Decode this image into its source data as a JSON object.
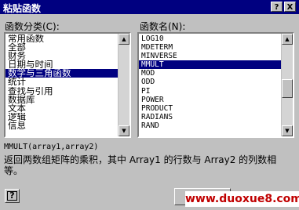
{
  "window": {
    "title": "粘贴函数",
    "help_glyph": "?",
    "close_glyph": "X"
  },
  "category": {
    "label": "函数分类(C):",
    "items": [
      "常用函数",
      "全部",
      "财务",
      "日期与时间",
      "数学与三角函数",
      "统计",
      "查找与引用",
      "数据库",
      "文本",
      "逻辑",
      "信息"
    ],
    "selected_index": 4
  },
  "function_names": {
    "label": "函数名(N):",
    "items": [
      "LOG10",
      "MDETERM",
      "MINVERSE",
      "MMULT",
      "MOD",
      "ODD",
      "PI",
      "POWER",
      "PRODUCT",
      "RADIANS",
      "RAND"
    ],
    "selected_index": 3
  },
  "syntax": "MMULT(array1,array2)",
  "description": "返回两数组矩阵的乘积，其中 Array1 的行数与 Array2 的列数相等。",
  "help_button_glyph": "?",
  "watermark": "www.duoxue8.com",
  "colors": {
    "titlebar": "#000080",
    "selection": "#000080",
    "dialog": "#c0c0c0",
    "watermark_text": "#c00000"
  }
}
